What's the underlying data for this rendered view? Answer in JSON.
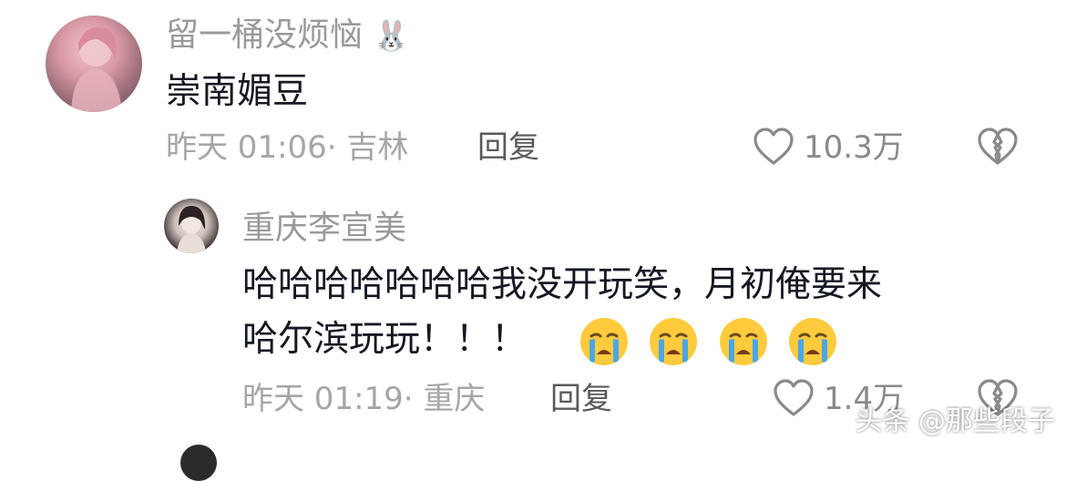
{
  "comment": {
    "username": "留一桶没烦恼",
    "username_emoji": "🐰",
    "text": "崇南媚豆",
    "time": "昨天 01:06·",
    "location": "吉林",
    "reply_label": "回复",
    "like_count": "10.3万"
  },
  "reply": {
    "username": "重庆李宣美",
    "text_line1": "哈哈哈哈哈哈哈我没开玩笑，月初俺要来",
    "text_line2": "哈尔滨玩玩！！！",
    "time": "昨天 01:19·",
    "location": "重庆",
    "reply_label": "回复",
    "like_count": "1.4万"
  },
  "watermark": "头条 @那些段子",
  "icons": [
    "heart-icon",
    "broken-heart-icon",
    "crying-face-emoji",
    "bunny-emoji"
  ]
}
